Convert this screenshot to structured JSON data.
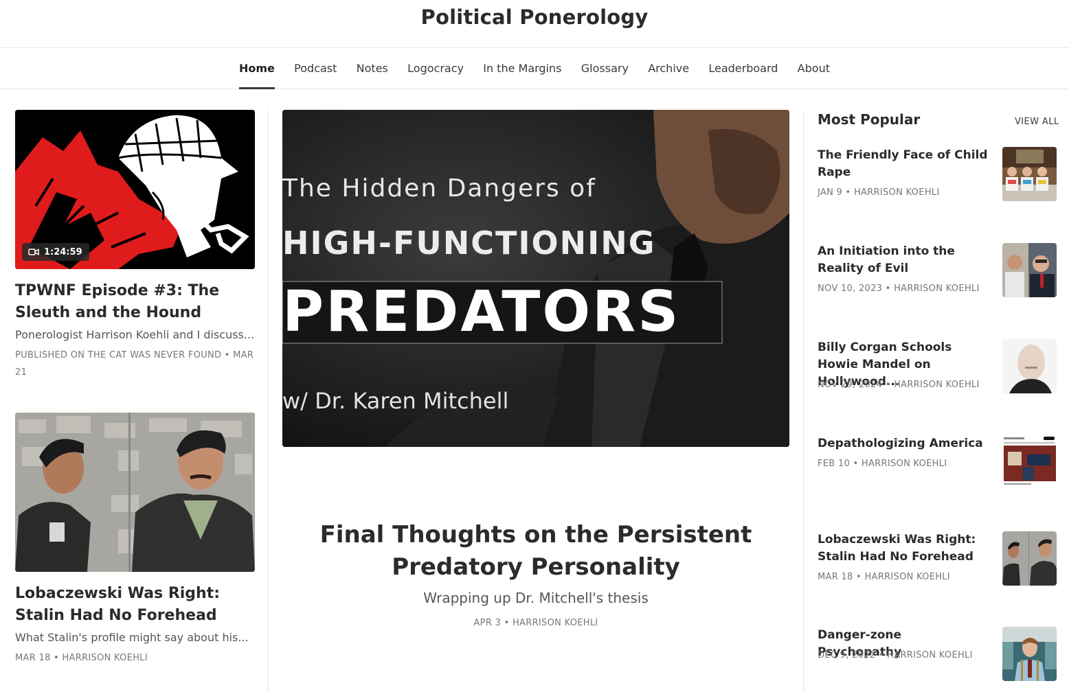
{
  "site": {
    "title": "Political Ponerology"
  },
  "nav": {
    "items": [
      {
        "label": "Home"
      },
      {
        "label": "Podcast"
      },
      {
        "label": "Notes"
      },
      {
        "label": "Logocracy"
      },
      {
        "label": "In the Margins"
      },
      {
        "label": "Glossary"
      },
      {
        "label": "Archive"
      },
      {
        "label": "Leaderboard"
      },
      {
        "label": "About"
      }
    ],
    "active": "Home"
  },
  "left_posts": [
    {
      "title": "TPWNF Episode #3: The Sleuth and the Hound",
      "subtitle": "Ponerologist Harrison Koehli and I discuss...",
      "meta": "PUBLISHED ON THE CAT WAS NEVER FOUND • MAR 21",
      "duration": "1:24:59",
      "icon": "video-camera-icon"
    },
    {
      "title": "Lobaczewski Was Right: Stalin Had No Forehead",
      "subtitle": "What Stalin's profile might say about his...",
      "meta": "MAR 18 • HARRISON KOEHLI"
    }
  ],
  "hero": {
    "image_text": {
      "line1": "The Hidden Dangers of",
      "line2": "HIGH-FUNCTIONING",
      "line3": "PREDATORS",
      "line4": "w/ Dr. Karen Mitchell"
    },
    "title": "Final Thoughts on the Persistent Predatory Personality",
    "subtitle": "Wrapping up Dr. Mitchell's thesis",
    "meta": "APR 3 • HARRISON KOEHLI"
  },
  "popular": {
    "heading": "Most Popular",
    "view_all": "VIEW ALL",
    "items": [
      {
        "title": "The Friendly Face of Child Rape",
        "meta": "JAN 9 • HARRISON KOEHLI"
      },
      {
        "title": "An Initiation into the Reality of Evil",
        "meta": "NOV 10, 2023 • HARRISON KOEHLI"
      },
      {
        "title": "Billy Corgan Schools Howie Mandel on Hollywood...",
        "meta": "NOV 29, 2024 • HARRISON KOEHLI"
      },
      {
        "title": "Depathologizing America",
        "meta": "FEB 10 • HARRISON KOEHLI"
      },
      {
        "title": "Lobaczewski Was Right: Stalin Had No Forehead",
        "meta": "MAR 18 • HARRISON KOEHLI"
      },
      {
        "title": "Danger-zone Psychopathy",
        "meta": "DEC 9, 2022 • HARRISON KOEHLI"
      }
    ]
  }
}
